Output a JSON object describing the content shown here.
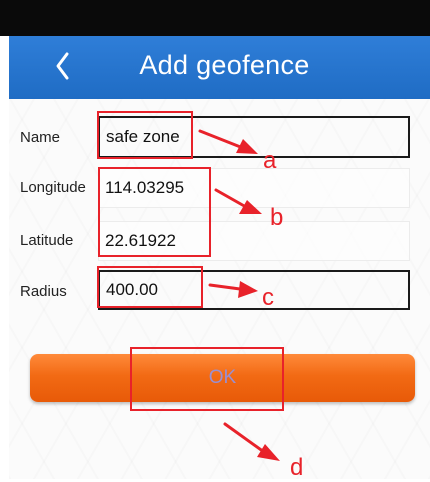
{
  "header": {
    "title": "Add geofence",
    "back_icon": "chevron-left-icon"
  },
  "form": {
    "name": {
      "label": "Name",
      "value": "safe zone"
    },
    "longitude": {
      "label": "Longitude",
      "value": "114.03295"
    },
    "latitude": {
      "label": "Latitude",
      "value": "22.61922"
    },
    "radius": {
      "label": "Radius",
      "value": "400.00"
    }
  },
  "ok_button": {
    "label": "OK"
  },
  "annotations": {
    "a": "a",
    "b": "b",
    "c": "c",
    "d": "d"
  },
  "colors": {
    "header_bg": "#2577d2",
    "status_bar": "#0a0a0a",
    "ok_button": "#f26a14",
    "annotation": "#e8222a"
  }
}
